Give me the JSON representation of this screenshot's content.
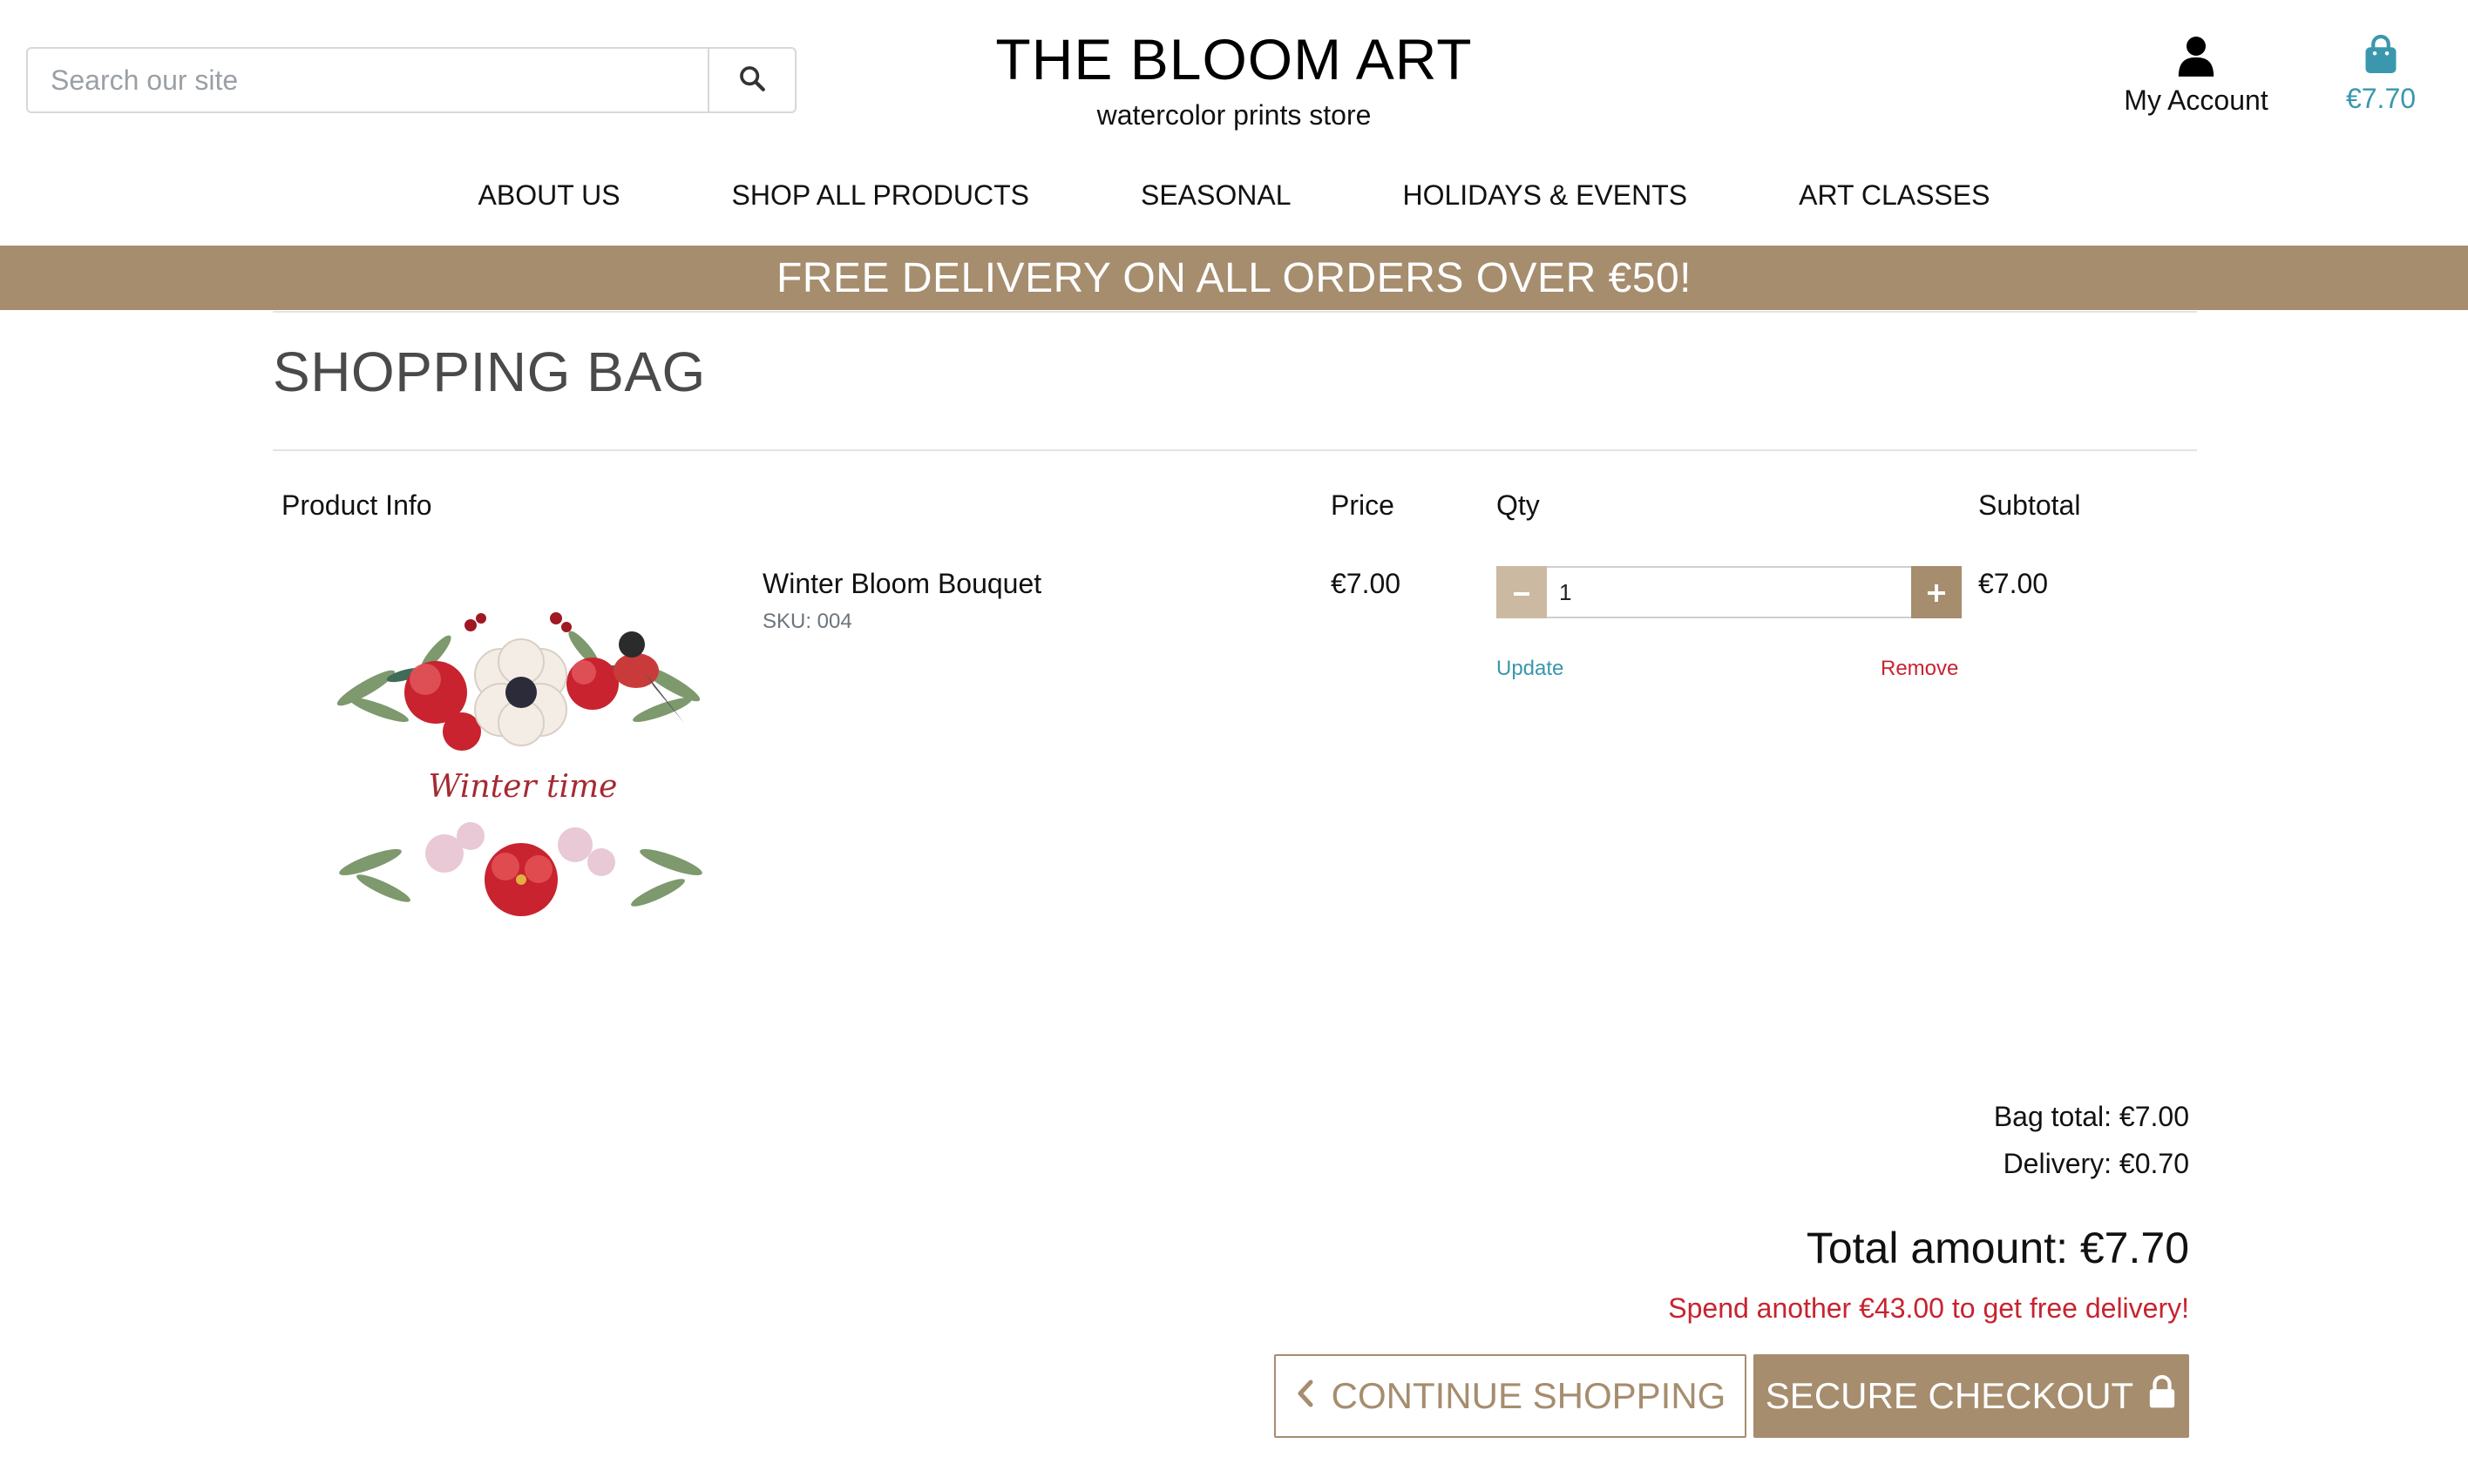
{
  "search": {
    "placeholder": "Search our site",
    "icon": "search-icon"
  },
  "brand": {
    "title": "THE BLOOM ART",
    "subtitle": "watercolor prints store"
  },
  "account": {
    "label": "My Account",
    "icon": "user-icon"
  },
  "bag": {
    "total": "€7.70",
    "icon": "shopping-bag-icon",
    "color": "#3a97ad"
  },
  "nav": {
    "items": [
      {
        "label": "ABOUT US"
      },
      {
        "label": "SHOP ALL PRODUCTS"
      },
      {
        "label": "SEASONAL"
      },
      {
        "label": "HOLIDAYS & EVENTS"
      },
      {
        "label": "ART CLASSES"
      }
    ]
  },
  "banner": {
    "text": "FREE DELIVERY ON ALL ORDERS OVER €50!",
    "color": "#a68d6e"
  },
  "page": {
    "title": "SHOPPING BAG"
  },
  "table": {
    "headers": {
      "product": "Product Info",
      "price": "Price",
      "qty": "Qty",
      "subtotal": "Subtotal"
    },
    "rows": [
      {
        "name": "Winter Bloom Bouquet",
        "sku": "SKU: 004",
        "price": "€7.00",
        "qty": "1",
        "subtotal": "€7.00",
        "update_label": "Update",
        "remove_label": "Remove",
        "image_caption": "Winter time"
      }
    ]
  },
  "summary": {
    "bag_total": "Bag total: €7.00",
    "delivery": "Delivery: €0.70",
    "total": "Total amount: €7.70",
    "free_delivery_msg": "Spend another €43.00 to get free delivery!"
  },
  "buttons": {
    "continue_label": "CONTINUE SHOPPING",
    "checkout_label": "SECURE CHECKOUT"
  },
  "colors": {
    "accent": "#a68d6e",
    "link": "#3a97ad",
    "danger": "#c8232f"
  }
}
